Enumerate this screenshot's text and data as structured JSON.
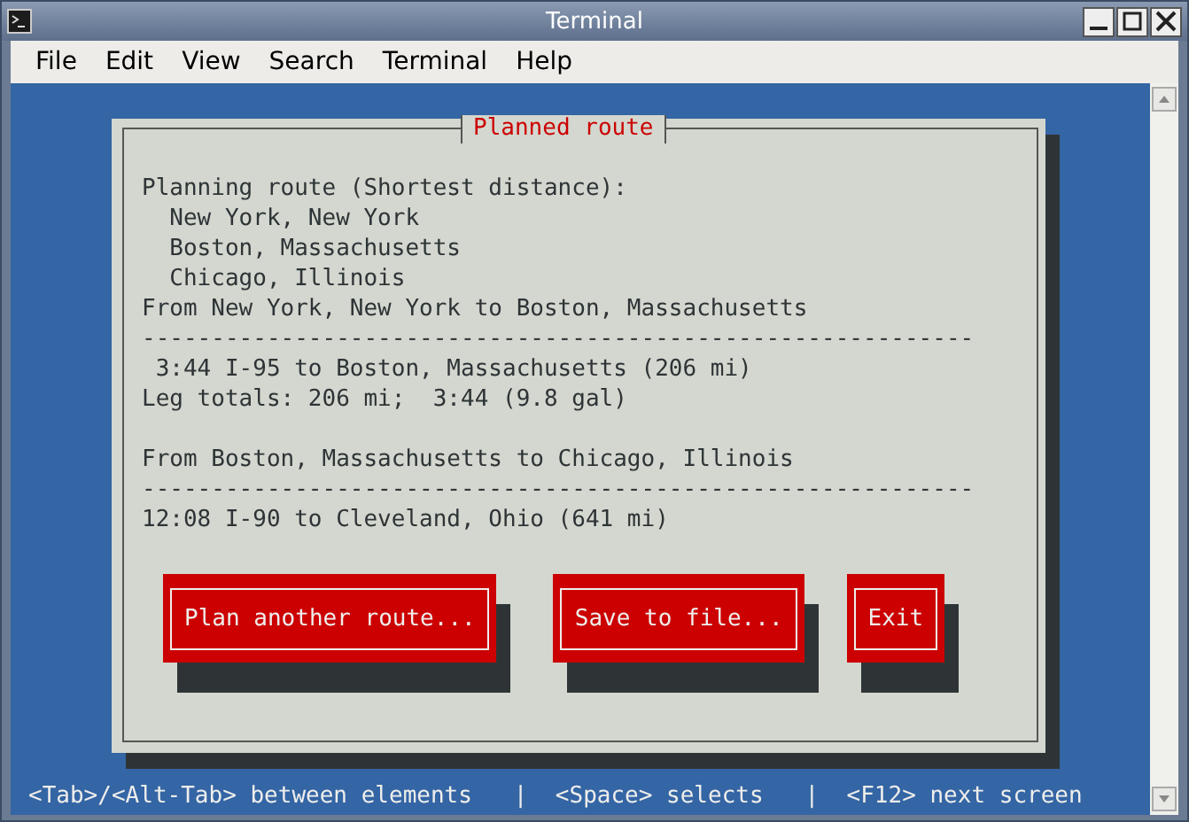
{
  "window": {
    "title": "Terminal"
  },
  "menu": [
    {
      "label": "File"
    },
    {
      "label": "Edit"
    },
    {
      "label": "View"
    },
    {
      "label": "Search"
    },
    {
      "label": "Terminal"
    },
    {
      "label": "Help"
    }
  ],
  "dialog": {
    "title": "Planned route",
    "blocks": [
      [
        "Planning route (Shortest distance):",
        "  New York, New York",
        "  Boston, Massachusetts",
        "  Chicago, Illinois",
        "From New York, New York to Boston, Massachusetts",
        "------------------------------------------------------------",
        " 3:44 I-95 to Boston, Massachusetts (206 mi)",
        "Leg totals: 206 mi;  3:44 (9.8 gal)"
      ],
      [
        "From Boston, Massachusetts to Chicago, Illinois",
        "------------------------------------------------------------",
        "12:08 I-90 to Cleveland, Ohio (641 mi)"
      ]
    ],
    "buttons": [
      {
        "label": "Plan another route..."
      },
      {
        "label": "Save to file..."
      },
      {
        "label": "Exit"
      }
    ]
  },
  "status_bar": "<Tab>/<Alt-Tab> between elements   |  <Space> selects   |  <F12> next screen"
}
